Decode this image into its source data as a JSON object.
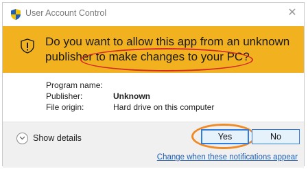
{
  "window": {
    "title": "User Account Control",
    "close_glyph": "✕"
  },
  "banner": {
    "question_line1": "Do you want to allow this app from an unknown",
    "question_line2": "publisher to make changes to your PC?",
    "icon": "warning-shield-icon",
    "color": "#f2b11f"
  },
  "details": {
    "rows": [
      {
        "label": "Program name:",
        "value": ""
      },
      {
        "label": "Publisher:",
        "value": "Unknown"
      },
      {
        "label": "File origin:",
        "value": "Hard drive on this computer"
      }
    ]
  },
  "footer": {
    "show_details_label": "Show details",
    "yes_label": "Yes",
    "no_label": "No",
    "change_link": "Change when these notifications appear"
  },
  "annotations": {
    "red_oval_color": "#d42a2a",
    "orange_oval_color": "#f08a24"
  }
}
